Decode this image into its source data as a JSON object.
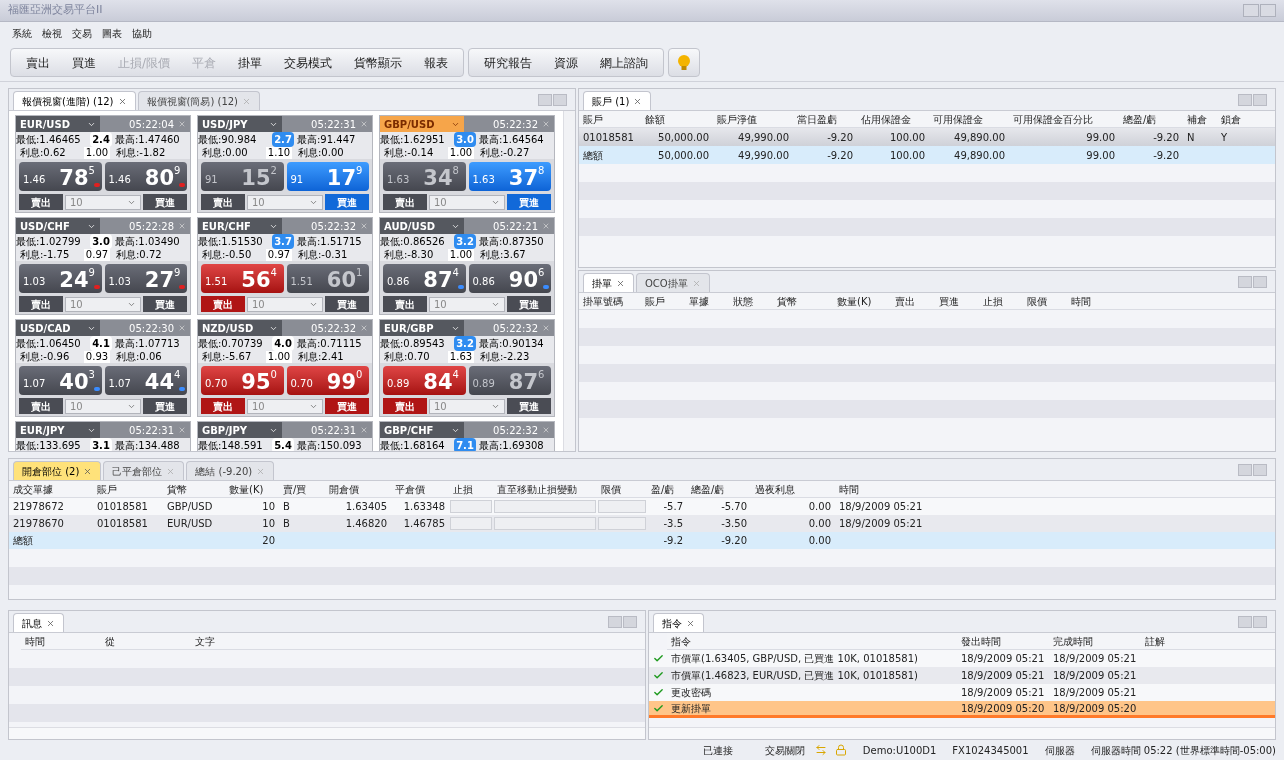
{
  "window": {
    "title": "福匯亞洲交易平台II"
  },
  "menu": [
    "系統",
    "檢視",
    "交易",
    "圖表",
    "協助"
  ],
  "toolbar": [
    [
      {
        "label": "賣出",
        "disabled": false
      },
      {
        "label": "買進",
        "disabled": false
      },
      {
        "label": "止損/限價",
        "disabled": true
      },
      {
        "label": "平倉",
        "disabled": true
      },
      {
        "label": "掛單",
        "disabled": false
      },
      {
        "label": "交易模式",
        "disabled": false
      },
      {
        "label": "貨幣顯示",
        "disabled": false
      },
      {
        "label": "報表",
        "disabled": false
      }
    ],
    [
      {
        "label": "研究報告",
        "disabled": false
      },
      {
        "label": "資源",
        "disabled": false
      },
      {
        "label": "網上諮詢",
        "disabled": false
      }
    ]
  ],
  "quotes": {
    "tabs": [
      {
        "label": "報價視窗(進階) (12)",
        "selected": true
      },
      {
        "label": "報價視窗(簡易) (12)",
        "selected": false
      }
    ],
    "cards": [
      {
        "pair": "EUR/USD",
        "highlighted": false,
        "time": "05:22:04",
        "low": "最低:1.46465",
        "spread": "2.4",
        "spread_alert": false,
        "high": "最高:1.47460",
        "interest_sell": "利息:0.62",
        "ratio": "1.00",
        "interest_buy": "利息:-1.82",
        "sell": {
          "prefix": "1.46",
          "big": "78",
          "pip": "5",
          "dim": false,
          "flash_up": false,
          "flash_down": false,
          "uptick": false,
          "downtick": true,
          "label": "賣出"
        },
        "buy": {
          "prefix": "1.46",
          "big": "80",
          "pip": "9",
          "dim": false,
          "flash_up": false,
          "flash_down": false,
          "uptick": false,
          "downtick": true,
          "label": "買進"
        },
        "amount": "10"
      },
      {
        "pair": "USD/JPY",
        "highlighted": false,
        "time": "05:22:31",
        "low": "最低:90.984",
        "spread": "2.7",
        "spread_alert": true,
        "high": "最高:91.447",
        "interest_sell": "利息:0.00",
        "ratio": "1.10",
        "interest_buy": "利息:0.00",
        "sell": {
          "prefix": "91",
          "big": "15",
          "pip": "2",
          "dim": true,
          "flash_up": false,
          "flash_down": false,
          "uptick": false,
          "downtick": false,
          "label": "賣出"
        },
        "buy": {
          "prefix": "91",
          "big": "17",
          "pip": "9",
          "dim": false,
          "flash_up": true,
          "flash_down": false,
          "uptick": false,
          "downtick": false,
          "label": "買進"
        },
        "amount": "10"
      },
      {
        "pair": "GBP/USD",
        "highlighted": true,
        "time": "05:22:32",
        "low": "最低:1.62951",
        "spread": "3.0",
        "spread_alert": true,
        "high": "最高:1.64564",
        "interest_sell": "利息:-0.14",
        "ratio": "1.00",
        "interest_buy": "利息:-0.27",
        "sell": {
          "prefix": "1.63",
          "big": "34",
          "pip": "8",
          "dim": true,
          "flash_up": false,
          "flash_down": false,
          "uptick": false,
          "downtick": false,
          "label": "賣出"
        },
        "buy": {
          "prefix": "1.63",
          "big": "37",
          "pip": "8",
          "dim": false,
          "flash_up": true,
          "flash_down": false,
          "uptick": false,
          "downtick": false,
          "label": "買進"
        },
        "amount": "10"
      },
      {
        "pair": "USD/CHF",
        "highlighted": false,
        "time": "05:22:28",
        "low": "最低:1.02799",
        "spread": "3.0",
        "spread_alert": false,
        "high": "最高:1.03490",
        "interest_sell": "利息:-1.75",
        "ratio": "0.97",
        "interest_buy": "利息:0.72",
        "sell": {
          "prefix": "1.03",
          "big": "24",
          "pip": "9",
          "dim": false,
          "flash_up": false,
          "flash_down": false,
          "uptick": false,
          "downtick": true,
          "label": "賣出"
        },
        "buy": {
          "prefix": "1.03",
          "big": "27",
          "pip": "9",
          "dim": false,
          "flash_up": false,
          "flash_down": false,
          "uptick": false,
          "downtick": true,
          "label": "買進"
        },
        "amount": "10"
      },
      {
        "pair": "EUR/CHF",
        "highlighted": false,
        "time": "05:22:32",
        "low": "最低:1.51530",
        "spread": "3.7",
        "spread_alert": true,
        "high": "最高:1.51715",
        "interest_sell": "利息:-0.50",
        "ratio": "0.97",
        "interest_buy": "利息:-0.31",
        "sell": {
          "prefix": "1.51",
          "big": "56",
          "pip": "4",
          "dim": false,
          "flash_up": false,
          "flash_down": true,
          "uptick": false,
          "downtick": false,
          "label": "賣出"
        },
        "buy": {
          "prefix": "1.51",
          "big": "60",
          "pip": "1",
          "dim": true,
          "flash_up": false,
          "flash_down": false,
          "uptick": false,
          "downtick": false,
          "label": "買進"
        },
        "amount": "10"
      },
      {
        "pair": "AUD/USD",
        "highlighted": false,
        "time": "05:22:21",
        "low": "最低:0.86526",
        "spread": "3.2",
        "spread_alert": true,
        "high": "最高:0.87350",
        "interest_sell": "利息:-8.30",
        "ratio": "1.00",
        "interest_buy": "利息:3.67",
        "sell": {
          "prefix": "0.86",
          "big": "87",
          "pip": "4",
          "dim": false,
          "flash_up": false,
          "flash_down": false,
          "uptick": true,
          "downtick": false,
          "label": "賣出"
        },
        "buy": {
          "prefix": "0.86",
          "big": "90",
          "pip": "6",
          "dim": false,
          "flash_up": false,
          "flash_down": false,
          "uptick": true,
          "downtick": false,
          "label": "買進"
        },
        "amount": "10"
      },
      {
        "pair": "USD/CAD",
        "highlighted": false,
        "time": "05:22:30",
        "low": "最低:1.06450",
        "spread": "4.1",
        "spread_alert": false,
        "high": "最高:1.07713",
        "interest_sell": "利息:-0.96",
        "ratio": "0.93",
        "interest_buy": "利息:0.06",
        "sell": {
          "prefix": "1.07",
          "big": "40",
          "pip": "3",
          "dim": false,
          "flash_up": false,
          "flash_down": false,
          "uptick": true,
          "downtick": false,
          "label": "賣出"
        },
        "buy": {
          "prefix": "1.07",
          "big": "44",
          "pip": "4",
          "dim": false,
          "flash_up": false,
          "flash_down": false,
          "uptick": true,
          "downtick": false,
          "label": "買進"
        },
        "amount": "10"
      },
      {
        "pair": "NZD/USD",
        "highlighted": false,
        "time": "05:22:32",
        "low": "最低:0.70739",
        "spread": "4.0",
        "spread_alert": false,
        "high": "最高:0.71115",
        "interest_sell": "利息:-5.67",
        "ratio": "1.00",
        "interest_buy": "利息:2.41",
        "sell": {
          "prefix": "0.70",
          "big": "95",
          "pip": "0",
          "dim": false,
          "flash_up": false,
          "flash_down": true,
          "uptick": false,
          "downtick": false,
          "label": "賣出"
        },
        "buy": {
          "prefix": "0.70",
          "big": "99",
          "pip": "0",
          "dim": false,
          "flash_up": false,
          "flash_down": true,
          "uptick": false,
          "downtick": false,
          "label": "買進"
        },
        "amount": "10"
      },
      {
        "pair": "EUR/GBP",
        "highlighted": false,
        "time": "05:22:32",
        "low": "最低:0.89543",
        "spread": "3.2",
        "spread_alert": true,
        "high": "最高:0.90134",
        "interest_sell": "利息:0.70",
        "ratio": "1.63",
        "interest_buy": "利息:-2.23",
        "sell": {
          "prefix": "0.89",
          "big": "84",
          "pip": "4",
          "dim": false,
          "flash_up": false,
          "flash_down": true,
          "uptick": false,
          "downtick": false,
          "label": "賣出"
        },
        "buy": {
          "prefix": "0.89",
          "big": "87",
          "pip": "6",
          "dim": true,
          "flash_up": false,
          "flash_down": false,
          "uptick": false,
          "downtick": false,
          "label": "買進"
        },
        "amount": "10"
      },
      {
        "pair": "EUR/JPY",
        "highlighted": false,
        "time": "05:22:31",
        "low": "最低:133.695",
        "spread": "3.1",
        "spread_alert": false,
        "high": "最高:134.488"
      },
      {
        "pair": "GBP/JPY",
        "highlighted": false,
        "time": "05:22:31",
        "low": "最低:148.591",
        "spread": "5.4",
        "spread_alert": false,
        "high": "最高:150.093"
      },
      {
        "pair": "GBP/CHF",
        "highlighted": false,
        "time": "05:22:32",
        "low": "最低:1.68164",
        "spread": "7.1",
        "spread_alert": true,
        "high": "最高:1.69308"
      }
    ]
  },
  "accounts": {
    "tabs": [
      {
        "label": "賬戶 (1)",
        "selected": true
      }
    ],
    "columns": [
      "賬戶",
      "餘額",
      "賬戶淨值",
      "當日盈虧",
      "佔用保證金",
      "可用保證金",
      "可用保證金百分比",
      "總盈/虧",
      "補倉",
      "鎖倉"
    ],
    "rows": [
      {
        "selected": false,
        "cells": [
          "01018581",
          "50,000.00",
          "49,990.00",
          "-9.20",
          "100.00",
          "49,890.00",
          "99.00",
          "-9.20",
          "N",
          "Y"
        ]
      },
      {
        "selected": true,
        "cells": [
          "總額",
          "50,000.00",
          "49,990.00",
          "-9.20",
          "100.00",
          "49,890.00",
          "99.00",
          "-9.20",
          null,
          null
        ]
      }
    ]
  },
  "orders": {
    "tabs": [
      {
        "label": "掛單",
        "selected": true
      },
      {
        "label": "OCO掛單",
        "selected": false
      }
    ],
    "columns": [
      "掛單號碼",
      "賬戶",
      "單據",
      "狀態",
      "貨幣",
      "數量(K)",
      "賣出",
      "買進",
      "止損",
      "限價",
      "時間"
    ]
  },
  "positions": {
    "tabs": [
      {
        "label": "開倉部位 (2)",
        "selected": true
      },
      {
        "label": "己平倉部位",
        "selected": false
      },
      {
        "label": "總結 (-9.20)",
        "selected": false
      }
    ],
    "columns": [
      "成交單據",
      "賬戶",
      "貨幣",
      "數量(K)",
      "賣/買",
      "開倉價",
      "平倉價",
      "止損",
      "直至移動止損變動",
      "限價",
      "盈/虧",
      "總盈/虧",
      "過夜利息",
      "時間"
    ],
    "rows": [
      {
        "kind": "position",
        "selected": false,
        "cells": [
          "21978672",
          "01018581",
          "GBP/USD",
          "10",
          "B",
          "1.63405",
          "1.63348",
          null,
          null,
          null,
          "-5.7",
          "-5.70",
          "0.00",
          "18/9/2009 05:21"
        ]
      },
      {
        "kind": "position",
        "selected": false,
        "cells": [
          "21978670",
          "01018581",
          "EUR/USD",
          "10",
          "B",
          "1.46820",
          "1.46785",
          null,
          null,
          null,
          "-3.5",
          "-3.50",
          "0.00",
          "18/9/2009 05:21"
        ]
      },
      {
        "kind": "total",
        "selected": true,
        "cells": [
          "總額",
          null,
          null,
          "20",
          null,
          null,
          null,
          null,
          null,
          null,
          "-9.2",
          "-9.20",
          "0.00",
          null
        ]
      }
    ]
  },
  "messages": {
    "tabs": [
      {
        "label": "訊息",
        "selected": true
      }
    ],
    "columns": [
      "時間",
      "從",
      "文字"
    ]
  },
  "commands": {
    "tabs": [
      {
        "label": "指令",
        "selected": true
      }
    ],
    "columns": [
      "指令",
      "發出時間",
      "完成時間",
      "註解"
    ],
    "rows": [
      {
        "done": true,
        "selected": false,
        "cells": [
          "市價單(1.63405, GBP/USD, 已買進 10K, 01018581)",
          "18/9/2009 05:21",
          "18/9/2009 05:21"
        ]
      },
      {
        "done": true,
        "selected": false,
        "cells": [
          "市價單(1.46823, EUR/USD, 已買進 10K, 01018581)",
          "18/9/2009 05:21",
          "18/9/2009 05:21"
        ]
      },
      {
        "done": true,
        "selected": false,
        "cells": [
          "更改密碼",
          "18/9/2009 05:21",
          "18/9/2009 05:21"
        ]
      },
      {
        "done": true,
        "selected": true,
        "cells": [
          "更新掛單",
          "18/9/2009 05:20",
          "18/9/2009 05:20"
        ]
      }
    ]
  },
  "status_bar": {
    "connection": "已連接",
    "trading": "交易關閉",
    "user": "Demo:U100D1",
    "account": "FX1024345001",
    "server": "伺服器",
    "server_time": "伺服器時間 05:22 (世界標準時間-05:00)"
  }
}
